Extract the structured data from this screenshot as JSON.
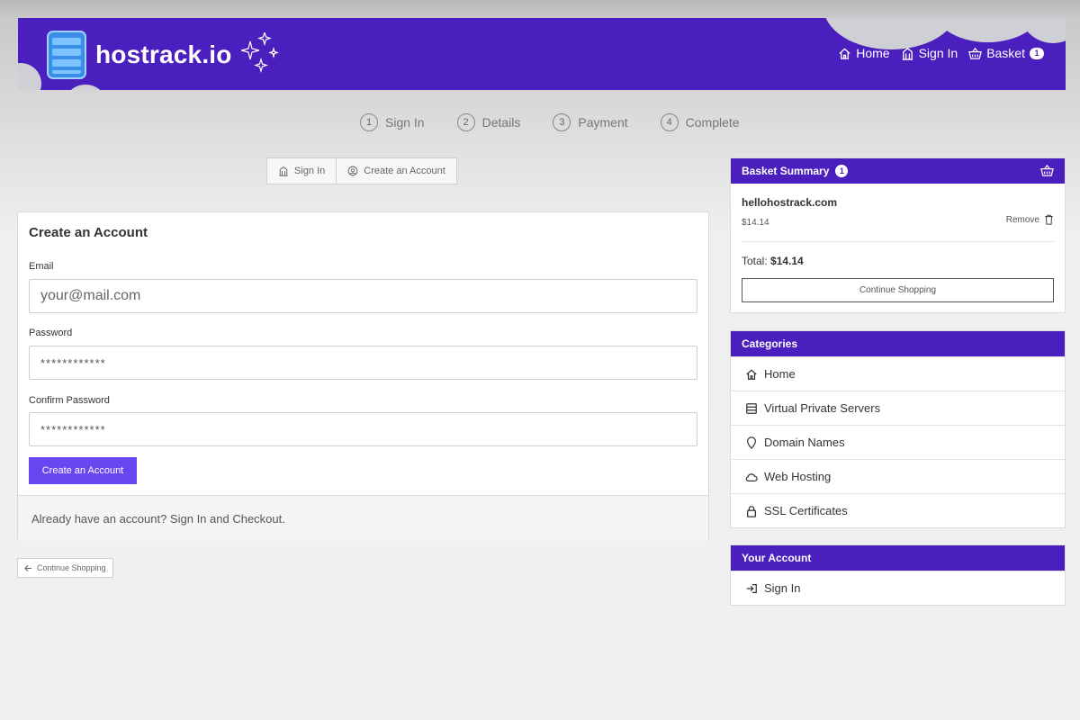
{
  "brand": {
    "name": "hostrack.io"
  },
  "topnav": {
    "home": "Home",
    "sign_in": "Sign In",
    "basket": "Basket",
    "basket_count": "1"
  },
  "steps": [
    {
      "num": "1",
      "label": "Sign In"
    },
    {
      "num": "2",
      "label": "Details"
    },
    {
      "num": "3",
      "label": "Payment"
    },
    {
      "num": "4",
      "label": "Complete"
    }
  ],
  "tabs": {
    "sign_in": "Sign In",
    "create": "Create an Account"
  },
  "form": {
    "title": "Create an Account",
    "email_label": "Email",
    "email_placeholder": "your@mail.com",
    "password_label": "Password",
    "password_value": "************",
    "confirm_label": "Confirm Password",
    "confirm_value": "************",
    "submit": "Create an Account",
    "footer_text": "Already have an account? Sign In and Checkout."
  },
  "back_button": "Continue Shopping",
  "basket": {
    "title": "Basket Summary",
    "count": "1",
    "item_name": "hellohostrack.com",
    "item_price": "$14.14",
    "remove": "Remove",
    "total_label": "Total:",
    "total_value": "$14.14",
    "continue": "Continue Shopping"
  },
  "categories": {
    "title": "Categories",
    "items": [
      {
        "label": "Home",
        "icon": "home-icon"
      },
      {
        "label": "Virtual Private Servers",
        "icon": "server-icon"
      },
      {
        "label": "Domain Names",
        "icon": "location-pin-icon"
      },
      {
        "label": "Web Hosting",
        "icon": "cloud-icon"
      },
      {
        "label": "SSL Certificates",
        "icon": "lock-icon"
      }
    ]
  },
  "account": {
    "title": "Your Account",
    "sign_in": "Sign In"
  },
  "colors": {
    "brand": "#4a1fbe",
    "button": "#6947f0"
  }
}
